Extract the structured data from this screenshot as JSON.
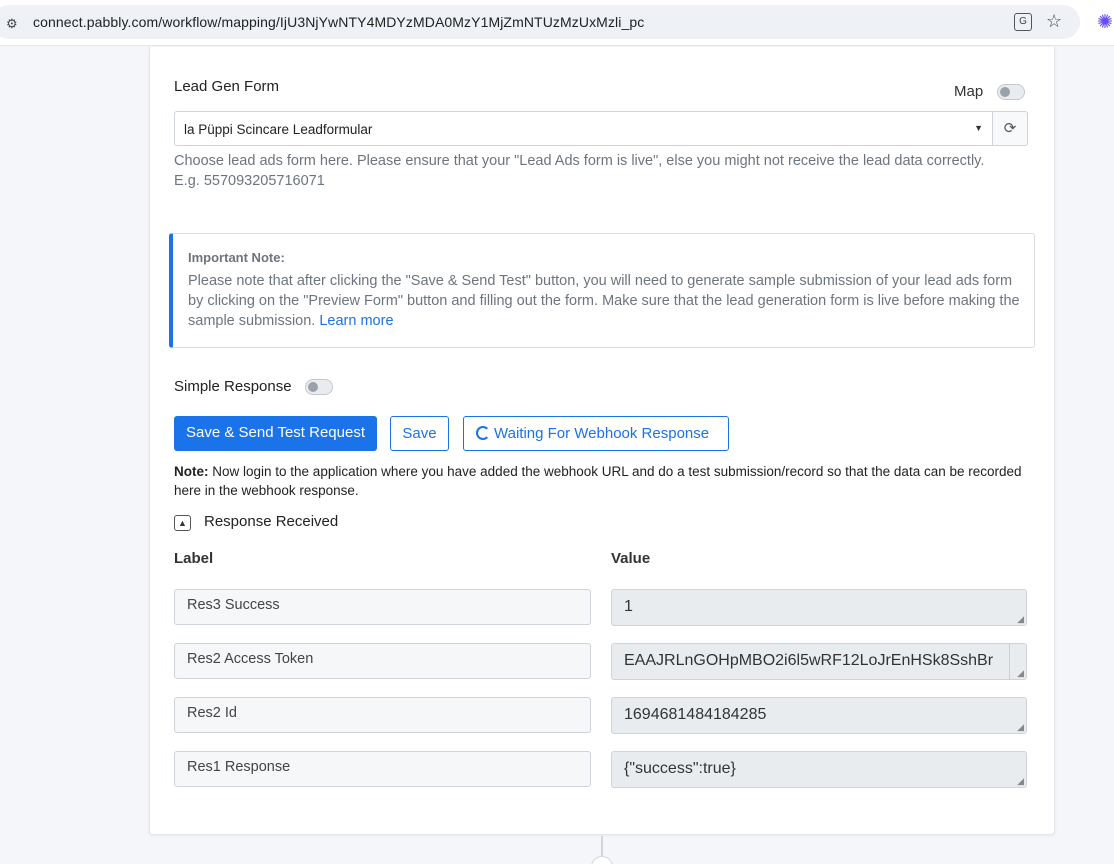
{
  "browser": {
    "url": "connect.pabbly.com/workflow/mapping/IjU3NjYwNTY4MDYzMDA0MzY1MjZmNTUzMzUxMzli_pc",
    "site_icon": "tune-icon",
    "translate_icon": "translate-icon",
    "bookmark_icon": "star-icon",
    "extension_icon": "extension-icon"
  },
  "form": {
    "lead_gen_label": "Lead Gen Form",
    "map_label": "Map",
    "map_enabled": false,
    "selected_form": "la Püppi Scincare Leadformular",
    "help_text": "Choose lead ads form here. Please ensure that your \"Lead Ads form is live\", else you might not receive the lead data correctly. E.g. 557093205716071"
  },
  "important_note": {
    "title": "Important Note:",
    "body": "Please note that after clicking the \"Save & Send Test\" button, you will need to generate sample submission of your lead ads form by clicking on the \"Preview Form\" button and filling out the form. Make sure that the lead generation form is live before making the sample submission.",
    "link": "Learn more"
  },
  "simple_response": {
    "label": "Simple Response",
    "enabled": false
  },
  "actions": {
    "save_send_label": "Save & Send Test Request",
    "save_label": "Save",
    "waiting_label": "Waiting For Webhook Response"
  },
  "webhook_note": {
    "prefix": "Note:",
    "text": " Now login to the application where you have added the webhook URL and do a test submission/record so that the data can be recorded here in the webhook response."
  },
  "response": {
    "title": "Response Received",
    "label_header": "Label",
    "value_header": "Value",
    "rows": [
      {
        "label": "Res3 Success",
        "value": "1"
      },
      {
        "label": "Res2 Access Token",
        "value": "EAAJRLnGOHpMBO2i6l5wRF12LoJrEnHSk8SshBr"
      },
      {
        "label": "Res2 Id",
        "value": "1694681484184285"
      },
      {
        "label": "Res1 Response",
        "value": "{\"success\":true}"
      }
    ]
  },
  "colors": {
    "primary": "#1a73e8",
    "muted_text": "#6c757d"
  }
}
